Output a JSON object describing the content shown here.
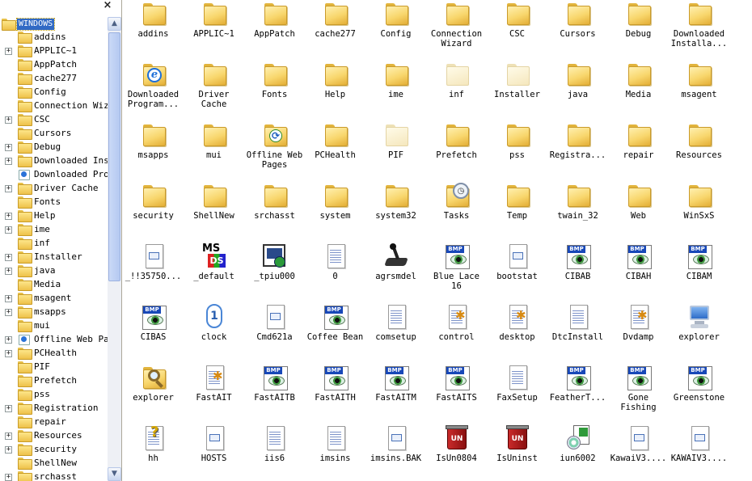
{
  "tree": {
    "close_glyph": "×",
    "root_label": "WINDOWS",
    "scroll_up": "▲",
    "scroll_down": "▼",
    "items": [
      {
        "label": "addins",
        "expandable": false,
        "icon": "folder-icon"
      },
      {
        "label": "APPLIC~1",
        "expandable": true,
        "icon": "folder-icon"
      },
      {
        "label": "AppPatch",
        "expandable": false,
        "icon": "folder-icon"
      },
      {
        "label": "cache277",
        "expandable": false,
        "icon": "folder-icon"
      },
      {
        "label": "Config",
        "expandable": false,
        "icon": "folder-icon"
      },
      {
        "label": "Connection Wize",
        "expandable": false,
        "icon": "folder-icon"
      },
      {
        "label": "CSC",
        "expandable": true,
        "icon": "folder-icon"
      },
      {
        "label": "Cursors",
        "expandable": false,
        "icon": "folder-icon"
      },
      {
        "label": "Debug",
        "expandable": true,
        "icon": "folder-icon"
      },
      {
        "label": "Downloaded Inst",
        "expandable": true,
        "icon": "folder-icon"
      },
      {
        "label": "Downloaded Prog",
        "expandable": false,
        "icon": "special-folder-icon"
      },
      {
        "label": "Driver Cache",
        "expandable": true,
        "icon": "folder-icon"
      },
      {
        "label": "Fonts",
        "expandable": false,
        "icon": "folder-icon"
      },
      {
        "label": "Help",
        "expandable": true,
        "icon": "folder-icon"
      },
      {
        "label": "ime",
        "expandable": true,
        "icon": "folder-icon"
      },
      {
        "label": "inf",
        "expandable": false,
        "icon": "folder-icon"
      },
      {
        "label": "Installer",
        "expandable": true,
        "icon": "folder-icon"
      },
      {
        "label": "java",
        "expandable": true,
        "icon": "folder-icon"
      },
      {
        "label": "Media",
        "expandable": false,
        "icon": "folder-icon"
      },
      {
        "label": "msagent",
        "expandable": true,
        "icon": "folder-icon"
      },
      {
        "label": "msapps",
        "expandable": true,
        "icon": "folder-icon"
      },
      {
        "label": "mui",
        "expandable": false,
        "icon": "folder-icon"
      },
      {
        "label": "Offline Web Pag",
        "expandable": true,
        "icon": "special-folder-icon"
      },
      {
        "label": "PCHealth",
        "expandable": true,
        "icon": "folder-icon"
      },
      {
        "label": "PIF",
        "expandable": false,
        "icon": "folder-icon"
      },
      {
        "label": "Prefetch",
        "expandable": false,
        "icon": "folder-icon"
      },
      {
        "label": "pss",
        "expandable": false,
        "icon": "folder-icon"
      },
      {
        "label": "Registration",
        "expandable": true,
        "icon": "folder-icon"
      },
      {
        "label": "repair",
        "expandable": false,
        "icon": "folder-icon"
      },
      {
        "label": "Resources",
        "expandable": true,
        "icon": "folder-icon"
      },
      {
        "label": "security",
        "expandable": true,
        "icon": "folder-icon"
      },
      {
        "label": "ShellNew",
        "expandable": false,
        "icon": "folder-icon"
      },
      {
        "label": "srchasst",
        "expandable": true,
        "icon": "folder-icon"
      }
    ]
  },
  "files": [
    {
      "label": "addins",
      "icon": "folder-icon"
    },
    {
      "label": "APPLIC~1",
      "icon": "folder-icon"
    },
    {
      "label": "AppPatch",
      "icon": "folder-icon"
    },
    {
      "label": "cache277",
      "icon": "folder-icon"
    },
    {
      "label": "Config",
      "icon": "folder-icon"
    },
    {
      "label": "Connection Wizard",
      "icon": "folder-icon"
    },
    {
      "label": "CSC",
      "icon": "folder-icon"
    },
    {
      "label": "Cursors",
      "icon": "folder-icon"
    },
    {
      "label": "Debug",
      "icon": "folder-icon"
    },
    {
      "label": "Downloaded Installa...",
      "icon": "folder-icon"
    },
    {
      "label": "Downloaded Program...",
      "icon": "ie-folder-icon"
    },
    {
      "label": "Driver Cache",
      "icon": "folder-icon"
    },
    {
      "label": "Fonts",
      "icon": "folder-icon"
    },
    {
      "label": "Help",
      "icon": "folder-icon"
    },
    {
      "label": "ime",
      "icon": "folder-icon"
    },
    {
      "label": "inf",
      "icon": "hidden-folder-icon"
    },
    {
      "label": "Installer",
      "icon": "hidden-folder-icon"
    },
    {
      "label": "java",
      "icon": "folder-icon"
    },
    {
      "label": "Media",
      "icon": "folder-icon"
    },
    {
      "label": "msagent",
      "icon": "folder-icon"
    },
    {
      "label": "msapps",
      "icon": "folder-icon"
    },
    {
      "label": "mui",
      "icon": "folder-icon"
    },
    {
      "label": "Offline Web Pages",
      "icon": "offline-folder-icon"
    },
    {
      "label": "PCHealth",
      "icon": "folder-icon"
    },
    {
      "label": "PIF",
      "icon": "hidden-folder-icon"
    },
    {
      "label": "Prefetch",
      "icon": "folder-icon"
    },
    {
      "label": "pss",
      "icon": "folder-icon"
    },
    {
      "label": "Registra...",
      "icon": "folder-icon"
    },
    {
      "label": "repair",
      "icon": "folder-icon"
    },
    {
      "label": "Resources",
      "icon": "folder-icon"
    },
    {
      "label": "security",
      "icon": "folder-icon"
    },
    {
      "label": "ShellNew",
      "icon": "folder-icon"
    },
    {
      "label": "srchasst",
      "icon": "folder-icon"
    },
    {
      "label": "system",
      "icon": "folder-icon"
    },
    {
      "label": "system32",
      "icon": "folder-icon"
    },
    {
      "label": "Tasks",
      "icon": "tasks-folder-icon"
    },
    {
      "label": "Temp",
      "icon": "folder-icon"
    },
    {
      "label": "twain_32",
      "icon": "folder-icon"
    },
    {
      "label": "Web",
      "icon": "folder-icon"
    },
    {
      "label": "WinSxS",
      "icon": "folder-icon"
    },
    {
      "label": "_!!35750...",
      "icon": "unknown-file-icon"
    },
    {
      "label": "_default",
      "icon": "msn-file-icon"
    },
    {
      "label": "_tpiu000",
      "icon": "program-file-icon"
    },
    {
      "label": "0",
      "icon": "text-file-icon"
    },
    {
      "label": "agrsmdel",
      "icon": "joystick-file-icon"
    },
    {
      "label": "Blue Lace 16",
      "icon": "bmp-file-icon"
    },
    {
      "label": "bootstat",
      "icon": "unknown-file-icon"
    },
    {
      "label": "CIBAB",
      "icon": "bmp-file-icon"
    },
    {
      "label": "CIBAH",
      "icon": "bmp-file-icon"
    },
    {
      "label": "CIBAM",
      "icon": "bmp-file-icon"
    },
    {
      "label": "CIBAS",
      "icon": "bmp-file-icon"
    },
    {
      "label": "clock",
      "icon": "clock-file-icon"
    },
    {
      "label": "Cmd621a",
      "icon": "unknown-file-icon"
    },
    {
      "label": "Coffee Bean",
      "icon": "bmp-file-icon"
    },
    {
      "label": "comsetup",
      "icon": "text-file-icon"
    },
    {
      "label": "control",
      "icon": "settings-file-icon"
    },
    {
      "label": "desktop",
      "icon": "settings-file-icon"
    },
    {
      "label": "DtcInstall",
      "icon": "text-file-icon"
    },
    {
      "label": "Dvdamp",
      "icon": "settings-file-icon"
    },
    {
      "label": "explorer",
      "icon": "computer-file-icon"
    },
    {
      "label": "explorer",
      "icon": "search-file-icon"
    },
    {
      "label": "FastAIT",
      "icon": "settings-file-icon"
    },
    {
      "label": "FastAITB",
      "icon": "bmp-file-icon"
    },
    {
      "label": "FastAITH",
      "icon": "bmp-file-icon"
    },
    {
      "label": "FastAITM",
      "icon": "bmp-file-icon"
    },
    {
      "label": "FastAITS",
      "icon": "bmp-file-icon"
    },
    {
      "label": "FaxSetup",
      "icon": "text-file-icon"
    },
    {
      "label": "FeatherT...",
      "icon": "bmp-file-icon"
    },
    {
      "label": "Gone Fishing",
      "icon": "bmp-file-icon"
    },
    {
      "label": "Greenstone",
      "icon": "bmp-file-icon"
    },
    {
      "label": "hh",
      "icon": "help-file-icon"
    },
    {
      "label": "HOSTS",
      "icon": "unknown-file-icon"
    },
    {
      "label": "iis6",
      "icon": "text-file-icon"
    },
    {
      "label": "imsins",
      "icon": "text-file-icon"
    },
    {
      "label": "imsins.BAK",
      "icon": "unknown-file-icon"
    },
    {
      "label": "IsUn0804",
      "icon": "uninstall-file-icon"
    },
    {
      "label": "IsUninst",
      "icon": "uninstall-file-icon"
    },
    {
      "label": "iun6002",
      "icon": "installer-file-icon"
    },
    {
      "label": "KawaiV3....",
      "icon": "unknown-file-icon"
    },
    {
      "label": "KAWAIV3....",
      "icon": "unknown-file-icon"
    }
  ]
}
